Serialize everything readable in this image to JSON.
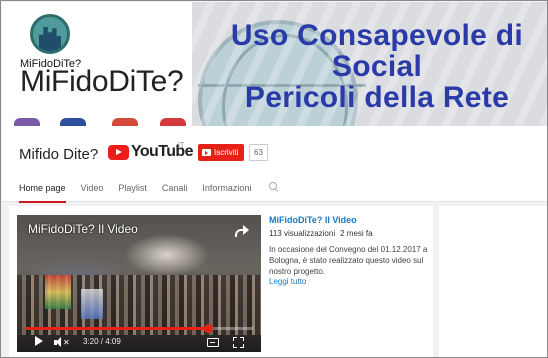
{
  "banner": {
    "logo_caption": "MiFidoDiTe?",
    "channel_wordmark": "MiFidoDiTe?",
    "title_lines": [
      "Uso Consapevole di",
      "Social",
      "Pericoli della Rete"
    ]
  },
  "header": {
    "channel_name": "Mifido Dite?",
    "youtube_word": "YouTube",
    "youtube_region": "IT",
    "subscribe_label": "Iscriviti",
    "subscriber_count": "63"
  },
  "tabs": [
    {
      "label": "Home page",
      "active": true
    },
    {
      "label": "Video",
      "active": false
    },
    {
      "label": "Playlist",
      "active": false
    },
    {
      "label": "Canali",
      "active": false
    },
    {
      "label": "Informazioni",
      "active": false
    }
  ],
  "video": {
    "player_title": "MiFidoDiTe? Il Video",
    "time": "3:20 / 4:09",
    "progress": 0.803,
    "title": "MiFidoDiTe? Il Video",
    "views": "113 visualizzazioni",
    "age": "2 mesi fa",
    "description": "In occasione del Convegno del 01.12.2017 a Bologna, è stato realizzato questo video sul nostro progetto.",
    "read_more": "Leggi tutto"
  },
  "colors": {
    "accent_red": "#e62117",
    "link_blue": "#167ac6",
    "banner_title": "#2a3aa8"
  }
}
